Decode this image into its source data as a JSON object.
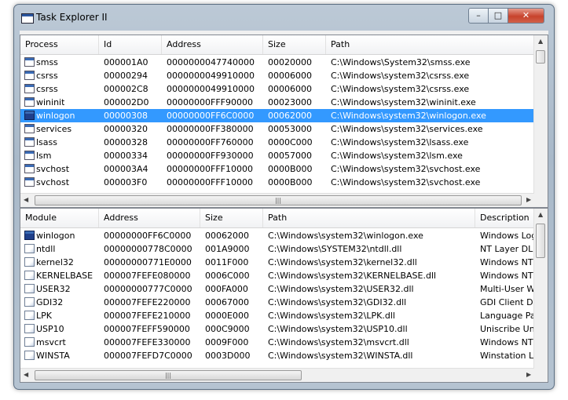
{
  "window": {
    "title": "Task Explorer II",
    "minimize": "–",
    "maximize": "□",
    "close": "✕"
  },
  "process_table": {
    "columns": [
      "Process",
      "Id",
      "Address",
      "Size",
      "Path"
    ],
    "rows": [
      {
        "name": "smss",
        "id": "000001A0",
        "address": "0000000047740000",
        "size": "00020000",
        "path": "C:\\Windows\\System32\\smss.exe",
        "icon": "app-window-icon"
      },
      {
        "name": "csrss",
        "id": "00000294",
        "address": "0000000049910000",
        "size": "00006000",
        "path": "C:\\Windows\\system32\\csrss.exe",
        "icon": "app-window-icon"
      },
      {
        "name": "csrss",
        "id": "000002C8",
        "address": "0000000049910000",
        "size": "00006000",
        "path": "C:\\Windows\\system32\\csrss.exe",
        "icon": "app-window-icon"
      },
      {
        "name": "wininit",
        "id": "000002D0",
        "address": "00000000FFF90000",
        "size": "00023000",
        "path": "C:\\Windows\\system32\\wininit.exe",
        "icon": "app-window-icon"
      },
      {
        "name": "winlogon",
        "id": "00000308",
        "address": "00000000FF6C0000",
        "size": "00062000",
        "path": "C:\\Windows\\system32\\winlogon.exe",
        "icon": "winlogon-icon"
      },
      {
        "name": "services",
        "id": "00000320",
        "address": "00000000FF380000",
        "size": "00053000",
        "path": "C:\\Windows\\system32\\services.exe",
        "icon": "app-window-icon"
      },
      {
        "name": "lsass",
        "id": "00000328",
        "address": "00000000FF760000",
        "size": "0000C000",
        "path": "C:\\Windows\\system32\\lsass.exe",
        "icon": "app-window-icon"
      },
      {
        "name": "lsm",
        "id": "00000334",
        "address": "00000000FF930000",
        "size": "00057000",
        "path": "C:\\Windows\\system32\\lsm.exe",
        "icon": "app-window-icon"
      },
      {
        "name": "svchost",
        "id": "000003A4",
        "address": "00000000FFF10000",
        "size": "0000B000",
        "path": "C:\\Windows\\system32\\svchost.exe",
        "icon": "app-window-icon"
      },
      {
        "name": "svchost",
        "id": "000003F0",
        "address": "00000000FFF10000",
        "size": "0000B000",
        "path": "C:\\Windows\\system32\\svchost.exe",
        "icon": "app-window-icon"
      }
    ],
    "selected_index": 4
  },
  "module_table": {
    "columns": [
      "Module",
      "Address",
      "Size",
      "Path",
      "Description"
    ],
    "rows": [
      {
        "name": "winlogon",
        "address": "00000000FF6C0000",
        "size": "00062000",
        "path": "C:\\Windows\\system32\\winlogon.exe",
        "description": "Windows Log",
        "icon": "winlogon-icon"
      },
      {
        "name": "ntdll",
        "address": "00000000778C0000",
        "size": "001A9000",
        "path": "C:\\Windows\\SYSTEM32\\ntdll.dll",
        "description": "NT Layer DLL",
        "icon": "dll-icon"
      },
      {
        "name": "kernel32",
        "address": "00000000771E0000",
        "size": "0011F000",
        "path": "C:\\Windows\\system32\\kernel32.dll",
        "description": "Windows NT",
        "icon": "dll-icon"
      },
      {
        "name": "KERNELBASE",
        "address": "000007FEFE080000",
        "size": "0006C000",
        "path": "C:\\Windows\\system32\\KERNELBASE.dll",
        "description": "Windows NT",
        "icon": "dll-icon"
      },
      {
        "name": "USER32",
        "address": "00000000777C0000",
        "size": "000FA000",
        "path": "C:\\Windows\\system32\\USER32.dll",
        "description": "Multi-User Wi",
        "icon": "dll-icon"
      },
      {
        "name": "GDI32",
        "address": "000007FEFE220000",
        "size": "00067000",
        "path": "C:\\Windows\\system32\\GDI32.dll",
        "description": "GDI Client DL",
        "icon": "dll-icon"
      },
      {
        "name": "LPK",
        "address": "000007FEFE210000",
        "size": "0000E000",
        "path": "C:\\Windows\\system32\\LPK.dll",
        "description": "Language Pa",
        "icon": "dll-icon"
      },
      {
        "name": "USP10",
        "address": "000007FEFF590000",
        "size": "000C9000",
        "path": "C:\\Windows\\system32\\USP10.dll",
        "description": "Uniscribe Uni",
        "icon": "dll-icon"
      },
      {
        "name": "msvcrt",
        "address": "000007FEFE330000",
        "size": "0009F000",
        "path": "C:\\Windows\\system32\\msvcrt.dll",
        "description": "Windows NT",
        "icon": "dll-icon"
      },
      {
        "name": "WINSTA",
        "address": "000007FEFD7C0000",
        "size": "0003D000",
        "path": "C:\\Windows\\system32\\WINSTA.dll",
        "description": "Winstation Lil",
        "icon": "dll-icon"
      }
    ]
  },
  "scrollbar": {
    "grip": "|||"
  }
}
